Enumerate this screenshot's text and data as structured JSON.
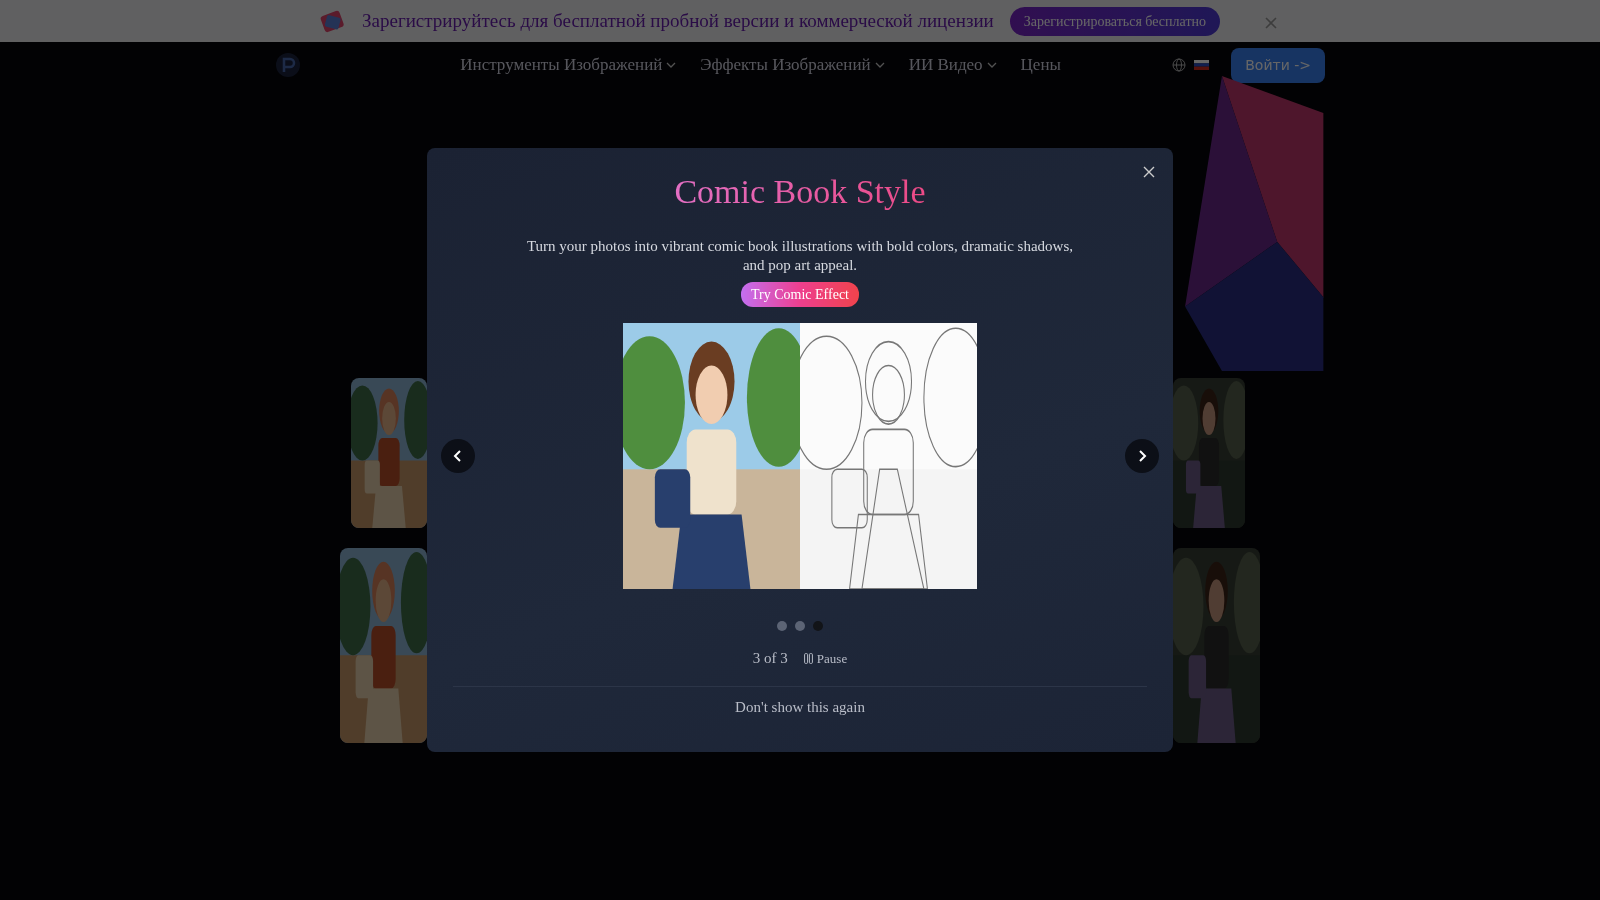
{
  "banner": {
    "text": "Зарегистрируйтесь для бесплатной пробной версии и коммерческой лицензии",
    "button": "Зарегистрироваться бесплатно"
  },
  "nav": {
    "menu": [
      {
        "label": "Инструменты Изображений",
        "dropdown": true
      },
      {
        "label": "Эффекты Изображений",
        "dropdown": true
      },
      {
        "label": "ИИ Видео",
        "dropdown": true
      },
      {
        "label": "Цены",
        "dropdown": false
      }
    ],
    "login": "Войти ->"
  },
  "modal": {
    "title": "Comic Book Style",
    "description": "Turn your photos into vibrant comic book illustrations with bold colors, dramatic shadows, and pop art appeal.",
    "cta": "Try Comic Effect",
    "slides": [
      {
        "selected": false
      },
      {
        "selected": false
      },
      {
        "selected": true
      }
    ],
    "counter": "3 of 3",
    "pause": "Pause",
    "dismiss": "Don't show this again"
  }
}
